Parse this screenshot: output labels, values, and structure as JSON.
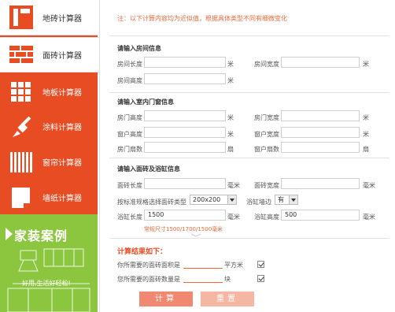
{
  "sidebar": {
    "items": [
      {
        "label": "地砖计算器",
        "icon": "floor-tile-icon"
      },
      {
        "label": "面砖计算器",
        "icon": "brick-wall-icon"
      },
      {
        "label": "地板计算器",
        "icon": "floor-board-icon"
      },
      {
        "label": "涂料计算器",
        "icon": "paint-brush-icon"
      },
      {
        "label": "窗帘计算器",
        "icon": "curtain-icon"
      },
      {
        "label": "墙纸计算器",
        "icon": "wallpaper-icon"
      }
    ],
    "case": {
      "title": "家装案例",
      "subtitle": "好用,生活好轻松!"
    }
  },
  "notice": "注：以下计算内容均为近似值，根据具体类型不同有细微变化",
  "room": {
    "title": "请输入房间信息",
    "length_label": "房间长度",
    "width_label": "房间宽度",
    "height_label": "房间高度",
    "unit": "米"
  },
  "doors": {
    "title": "请输入室内门窗信息",
    "door_height_label": "房门高度",
    "door_width_label": "房门宽度",
    "window_height_label": "窗户高度",
    "window_width_label": "窗户宽度",
    "door_count_label": "房门扇数",
    "window_count_label": "窗户扇数",
    "unit_m": "米",
    "unit_count": "扇"
  },
  "tile": {
    "title": "请输入面砖及浴缸信息",
    "length_label": "面砖长度",
    "width_label": "面砖宽度",
    "unit_mm": "毫米",
    "type_label": "按标准规格选择面砖类型",
    "type_value": "200x200",
    "border_label": "浴缸墙边",
    "border_value": "有",
    "bath_length_label": "浴缸长度",
    "bath_length_value": "1500",
    "bath_height_label": "浴缸高度",
    "bath_height_value": "500",
    "hint": "常规尺寸1500/1700/1500毫米"
  },
  "result": {
    "title": "计算结果如下：",
    "area_label": "你所需要的面砖面积是",
    "area_unit": "平方米",
    "count_label": "您所需要的面砖数量是",
    "count_unit": "块"
  },
  "buttons": {
    "calc": "计算",
    "reset": "重置"
  },
  "colors": {
    "brand": "#e84c22",
    "case_green": "#8cc63f",
    "hint": "#e86a3a"
  }
}
